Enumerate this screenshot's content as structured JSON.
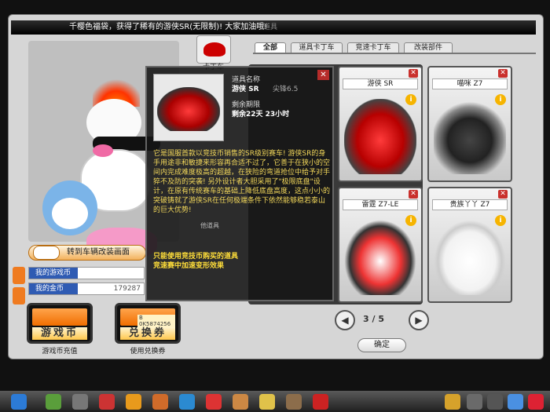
{
  "header": {
    "notice": "千樱色福袋，获得了稀有的游侠SR(无限制)! 大家加油哦!",
    "tail": "道具"
  },
  "avatar": {
    "change_clothes_label": "转到车辆改装画面",
    "car_badge_label": "卡丁车"
  },
  "currency": {
    "game_coin_label": "我的游戏币",
    "game_coin_value": "",
    "gold_coin_label": "我的金币",
    "gold_coin_value": "179287"
  },
  "buttons": {
    "game_coin": {
      "text": "游戏币",
      "caption": "游戏币充值"
    },
    "coupon": {
      "text": "兑换券",
      "caption": "使用兑换券",
      "code": "B 0K5874256"
    }
  },
  "tabs": [
    {
      "label": "全部",
      "active": true
    },
    {
      "label": "道具卡丁车",
      "active": false
    },
    {
      "label": "竞速卡丁车",
      "active": false
    },
    {
      "label": "改装部件",
      "active": false
    }
  ],
  "cards": [
    {
      "name": "游侠 SR",
      "close": "✕",
      "info": "i"
    },
    {
      "name": "喵咪 Z7",
      "close": "✕",
      "info": "i"
    },
    {
      "name": "雷霆 Z7-LE",
      "close": "✕",
      "info": "i"
    },
    {
      "name": "贵族丫丫 Z7",
      "close": "✕",
      "info": "i"
    }
  ],
  "pager": {
    "prev": "◀",
    "next": "▶",
    "text": "3 / 5"
  },
  "ok_button": "确定",
  "tooltip": {
    "name_label": "道具名称",
    "name_value": "游侠 SR",
    "grade": "尖锋6.5",
    "remaining_label": "剩余期限",
    "remaining_value": "剩余22天 23小时",
    "close": "✕",
    "description": "它是国服首款以竞技币销售的SR级别赛车! 游侠SR的身手用途非和敏捷来形容再合适不过了，它善于在狭小的空间内完成难度极高的超越，在狭险的弯道抢位中给予对手猝不及防的突袭! 另外设计者大胆采用了\"极限底盘\"设计，在原有传统赛车的基础上降低底盘高度，这点小小的突破铸就了游侠SR在任何极端条件下依然能够稳若泰山的巨大优势!",
    "note_line1": "只能使用竞技币购买的道具",
    "note_line2": "竞速赛中加速变形效果",
    "side_label": "他道具"
  },
  "colors": {
    "accent_orange": "#f06e00",
    "coin_blue": "#2f5bb3",
    "close_red": "#c9302c",
    "info_yellow": "#f6b400",
    "tooltip_text": "#f2d75a"
  }
}
